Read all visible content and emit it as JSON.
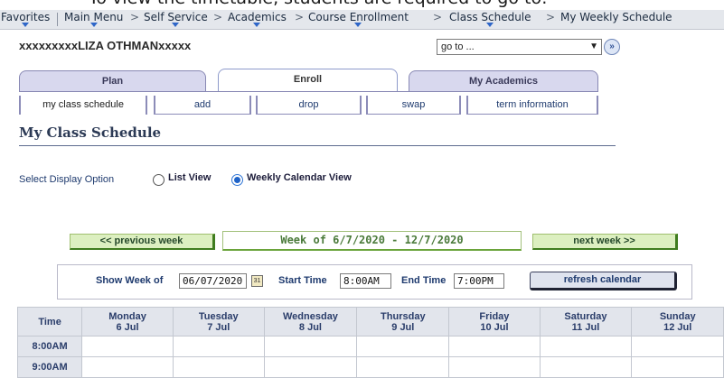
{
  "top_sentence": "To view the timetable, students are required to go to:",
  "breadcrumb": [
    {
      "label": "Favorites",
      "dropdown": true
    },
    {
      "label": "Main Menu",
      "dropdown": true
    },
    {
      "label": "Self Service",
      "dropdown": true
    },
    {
      "label": "Academics",
      "dropdown": true
    },
    {
      "label": "Course Enrollment",
      "dropdown": true
    },
    {
      "label": "Class Schedule",
      "dropdown": true
    },
    {
      "label": "My Weekly Schedule",
      "dropdown": false
    }
  ],
  "breadcrumb_separator": ">",
  "user": {
    "name": "xxxxxxxxxLIZA OTHMANxxxxx"
  },
  "goto": {
    "value": "go to ...",
    "button_icon": "double-chevron-right-icon"
  },
  "main_tabs": [
    {
      "label": "Plan",
      "active": false
    },
    {
      "label": "Enroll",
      "active": true
    },
    {
      "label": "My Academics",
      "active": false
    }
  ],
  "sub_tabs": [
    {
      "label": "my class schedule",
      "active": true
    },
    {
      "label": "add",
      "active": false
    },
    {
      "label": "drop",
      "active": false
    },
    {
      "label": "swap",
      "active": false
    },
    {
      "label": "term information",
      "active": false
    }
  ],
  "page_title": "My Class Schedule",
  "display_option": {
    "label": "Select Display Option",
    "options": [
      {
        "label": "List View",
        "selected": false
      },
      {
        "label": "Weekly Calendar View",
        "selected": true
      }
    ]
  },
  "week_nav": {
    "previous": "<< previous week",
    "current": "Week of 6/7/2020 - 12/7/2020",
    "next": "next week >>"
  },
  "filters": {
    "show_week_label": "Show Week of",
    "show_week_value": "06/07/2020",
    "calendar_icon": "calendar-icon",
    "start_label": "Start Time",
    "start_value": "8:00AM",
    "end_label": "End Time",
    "end_value": "7:00PM",
    "refresh_label": "refresh calendar"
  },
  "calendar": {
    "time_header": "Time",
    "days": [
      {
        "name": "Monday",
        "date": "6 Jul"
      },
      {
        "name": "Tuesday",
        "date": "7 Jul"
      },
      {
        "name": "Wednesday",
        "date": "8 Jul"
      },
      {
        "name": "Thursday",
        "date": "9 Jul"
      },
      {
        "name": "Friday",
        "date": "10 Jul"
      },
      {
        "name": "Saturday",
        "date": "11 Jul"
      },
      {
        "name": "Sunday",
        "date": "12 Jul"
      }
    ],
    "times": [
      "8:00AM",
      "9:00AM"
    ]
  },
  "colors": {
    "nav_bg": "#e4e7ec",
    "tab_bg": "#d8d8ee",
    "week_button_bg": "#dcefc0",
    "header_text": "#2a3d6a",
    "radio_selected": "#1f63c8"
  }
}
